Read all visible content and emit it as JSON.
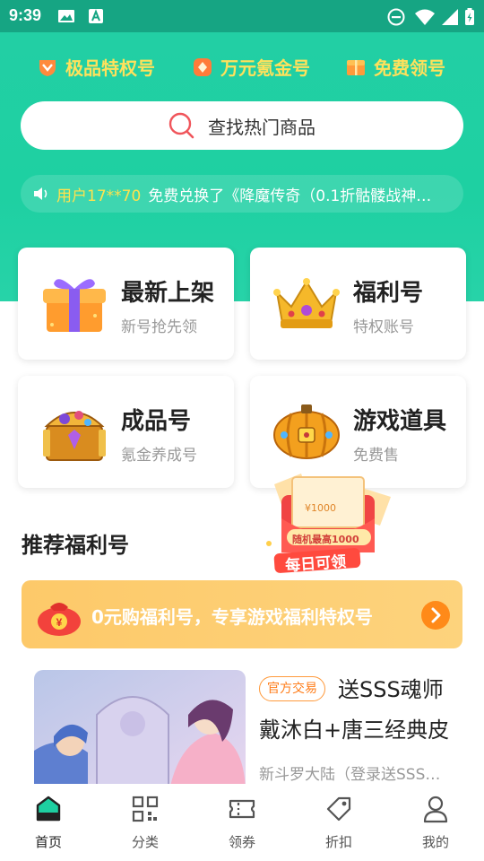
{
  "status_bar": {
    "time": "9:39"
  },
  "header": {
    "tags": [
      {
        "label": "极品特权号",
        "icon": "heart-badge-icon"
      },
      {
        "label": "万元氪金号",
        "icon": "diamond-badge-icon"
      },
      {
        "label": "免费领号",
        "icon": "gift-box-icon"
      }
    ],
    "search": {
      "label": "查找热门商品"
    },
    "notice": {
      "user": "用户17**70",
      "text": "免费兑换了《降魔传奇（0.1折骷髅战神…"
    }
  },
  "categories": [
    {
      "title": "最新上架",
      "subtitle": "新号抢先领",
      "icon": "gift-icon"
    },
    {
      "title": "福利号",
      "subtitle": "特权账号",
      "icon": "crown-icon"
    },
    {
      "title": "成品号",
      "subtitle": "氪金养成号",
      "icon": "treasure-chest-icon"
    },
    {
      "title": "游戏道具",
      "subtitle": "免费售",
      "icon": "pumpkin-treasure-icon"
    }
  ],
  "daily_coupon": {
    "amount": "¥1000",
    "caption": "随机最高1000",
    "label": "每日可领"
  },
  "section": {
    "title": "推荐福利号"
  },
  "banner": {
    "text": "0元购福利号，专享游戏福利特权号"
  },
  "product": {
    "badge": "官方交易",
    "title_line1": "送SSS魂师",
    "title_line2": "戴沐白+唐三经典皮",
    "desc": "新斗罗大陆（登录送SSS…"
  },
  "tabbar": [
    {
      "label": "首页",
      "icon": "home-shop-icon",
      "active": true
    },
    {
      "label": "分类",
      "icon": "grid-icon"
    },
    {
      "label": "领券",
      "icon": "ticket-icon"
    },
    {
      "label": "折扣",
      "icon": "tag-icon"
    },
    {
      "label": "我的",
      "icon": "user-icon"
    }
  ],
  "colors": {
    "primary": "#1ed0a2",
    "accent_yellow": "#ffe15c",
    "orange": "#ff8a19"
  }
}
